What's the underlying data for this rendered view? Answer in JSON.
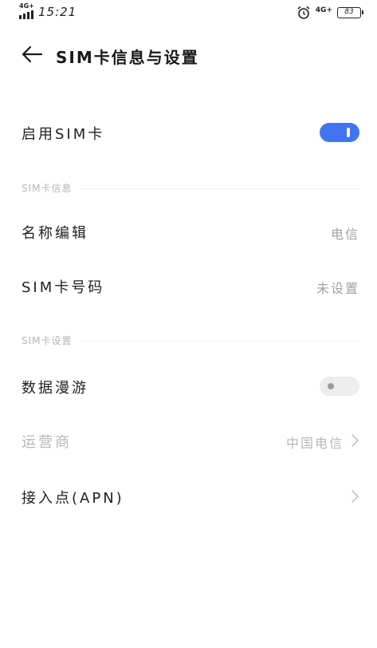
{
  "status_bar": {
    "network_left": "4G+",
    "time": "15:21",
    "network_right": "4G+",
    "battery": "83"
  },
  "header": {
    "title": "SIM卡信息与设置"
  },
  "enable_sim": {
    "label": "启用SIM卡",
    "enabled": true
  },
  "sections": {
    "sim_info": "SIM卡信息",
    "sim_settings": "SIM卡设置"
  },
  "name_edit": {
    "label": "名称编辑",
    "value": "电信"
  },
  "sim_number": {
    "label": "SIM卡号码",
    "value": "未设置"
  },
  "data_roaming": {
    "label": "数据漫游",
    "enabled": false
  },
  "carrier": {
    "label": "运营商",
    "value": "中国电信"
  },
  "apn": {
    "label": "接入点(APN)"
  },
  "colors": {
    "accent": "#4175f0",
    "disabled_text": "#b7b7b7",
    "secondary_text": "#a3a3a3"
  }
}
